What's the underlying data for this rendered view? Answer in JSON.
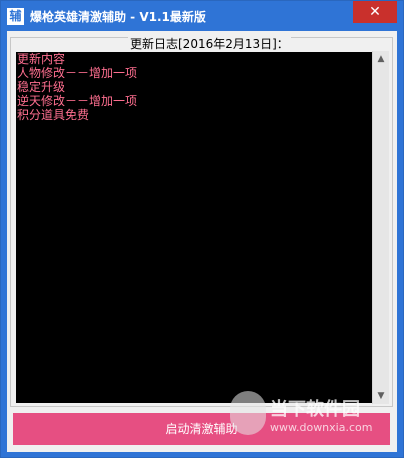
{
  "window": {
    "icon_glyph": "辅",
    "title": "爆枪英雄清激辅助 - V1.1最新版",
    "close_glyph": "✕",
    "accent_color": "#2f74d6"
  },
  "changelog": {
    "group_title": "更新日志[2016年2月13日]：",
    "lines": [
      "更新内容",
      "人物修改－－增加一项",
      "稳定升级",
      "逆天修改－－增加一项",
      "积分道具免费"
    ],
    "text_color": "#ff6f90"
  },
  "scrollbar": {
    "up_glyph": "▲",
    "down_glyph": "▼"
  },
  "actions": {
    "start_label": "启动清激辅助",
    "button_color": "#e64f82"
  },
  "watermark": {
    "title": "当下软件园",
    "url": "www.downxia.com"
  }
}
